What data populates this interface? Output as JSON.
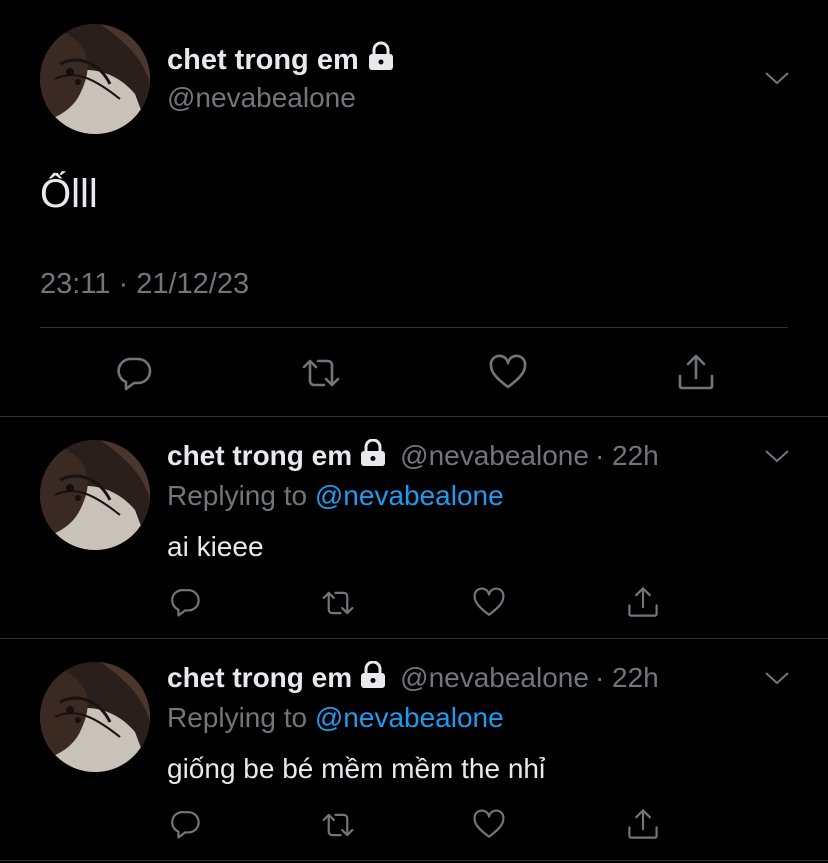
{
  "main_tweet": {
    "display_name": "chet trong em",
    "handle": "@nevabealone",
    "text": "Ốlll",
    "timestamp": "23:11 · 21/12/23"
  },
  "replies": [
    {
      "display_name": "chet trong em",
      "handle": "@nevabealone",
      "time": "· 22h",
      "replying_label": "Replying to",
      "replying_handle": "@nevabealone",
      "text": "ai kieee"
    },
    {
      "display_name": "chet trong em",
      "handle": "@nevabealone",
      "time": "· 22h",
      "replying_label": "Replying to",
      "replying_handle": "@nevabealone",
      "text": "giống be bé mềm mềm the nhỉ"
    }
  ],
  "icons": {
    "lock": "lock-icon",
    "more": "chevron-down-icon",
    "reply": "reply-icon",
    "retweet": "retweet-icon",
    "like": "heart-icon",
    "share": "share-icon"
  },
  "colors": {
    "background": "#000000",
    "text": "#e7e9ea",
    "muted": "#71767b",
    "link": "#1d9bf0",
    "divider": "#2f3336"
  }
}
